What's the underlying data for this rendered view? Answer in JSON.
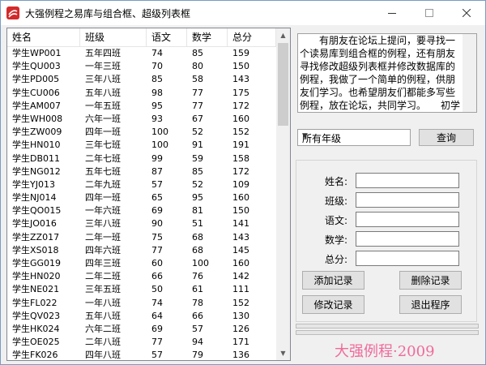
{
  "window": {
    "title": "大强例程之易库与组合框、超级列表框"
  },
  "colors": {
    "brand": "#f06a9a",
    "icon_red": "#d42a2a"
  },
  "list": {
    "columns": [
      "姓名",
      "班级",
      "语文",
      "数学",
      "总分"
    ],
    "rows": [
      [
        "学生WP001",
        "五年四班",
        "74",
        "85",
        "159"
      ],
      [
        "学生QU003",
        "一年三班",
        "70",
        "80",
        "150"
      ],
      [
        "学生PD005",
        "三年八班",
        "85",
        "58",
        "143"
      ],
      [
        "学生CU006",
        "五年八班",
        "98",
        "77",
        "175"
      ],
      [
        "学生AM007",
        "一年五班",
        "95",
        "77",
        "172"
      ],
      [
        "学生WH008",
        "六年一班",
        "93",
        "67",
        "160"
      ],
      [
        "学生ZW009",
        "四年一班",
        "100",
        "52",
        "152"
      ],
      [
        "学生HN010",
        "三年七班",
        "100",
        "91",
        "191"
      ],
      [
        "学生DB011",
        "二年七班",
        "99",
        "59",
        "158"
      ],
      [
        "学生NG012",
        "五年七班",
        "87",
        "85",
        "172"
      ],
      [
        "学生YJ013",
        "二年九班",
        "57",
        "52",
        "109"
      ],
      [
        "学生NJ014",
        "四年一班",
        "65",
        "95",
        "160"
      ],
      [
        "学生QO015",
        "一年六班",
        "69",
        "81",
        "150"
      ],
      [
        "学生JO016",
        "三年八班",
        "90",
        "51",
        "141"
      ],
      [
        "学生ZZ017",
        "二年一班",
        "75",
        "68",
        "143"
      ],
      [
        "学生XS018",
        "四年六班",
        "77",
        "68",
        "145"
      ],
      [
        "学生GG019",
        "四年三班",
        "60",
        "100",
        "160"
      ],
      [
        "学生HN020",
        "二年二班",
        "66",
        "76",
        "142"
      ],
      [
        "学生NE021",
        "三年五班",
        "50",
        "61",
        "111"
      ],
      [
        "学生FL022",
        "一年八班",
        "74",
        "78",
        "152"
      ],
      [
        "学生QV023",
        "五年八班",
        "64",
        "66",
        "130"
      ],
      [
        "学生HK024",
        "六年二班",
        "69",
        "57",
        "126"
      ],
      [
        "学生OE025",
        "二年八班",
        "77",
        "94",
        "171"
      ],
      [
        "学生FK026",
        "四年八班",
        "57",
        "79",
        "136"
      ]
    ]
  },
  "notice": {
    "text": "　　有朋友在论坛上提问，要寻找一个读易库到组合框的例程，还有朋友寻找修改超级列表框并修改数据库的例程，我做了一个简单的例程，供朋友们学习。也希望朋友们都能多写些例程，放在论坛，共同学习。　　初学的朋友请多看看易语言系统的知"
  },
  "filter": {
    "selected": "所有年级",
    "query_label": "查询"
  },
  "form": {
    "name_label": "姓名:",
    "class_label": "班级:",
    "chinese_label": "语文:",
    "math_label": "数学:",
    "total_label": "总分:"
  },
  "buttons": {
    "add": "添加记录",
    "delete": "删除记录",
    "edit": "修改记录",
    "exit": "退出程序"
  },
  "brand": "大强例程·2009"
}
